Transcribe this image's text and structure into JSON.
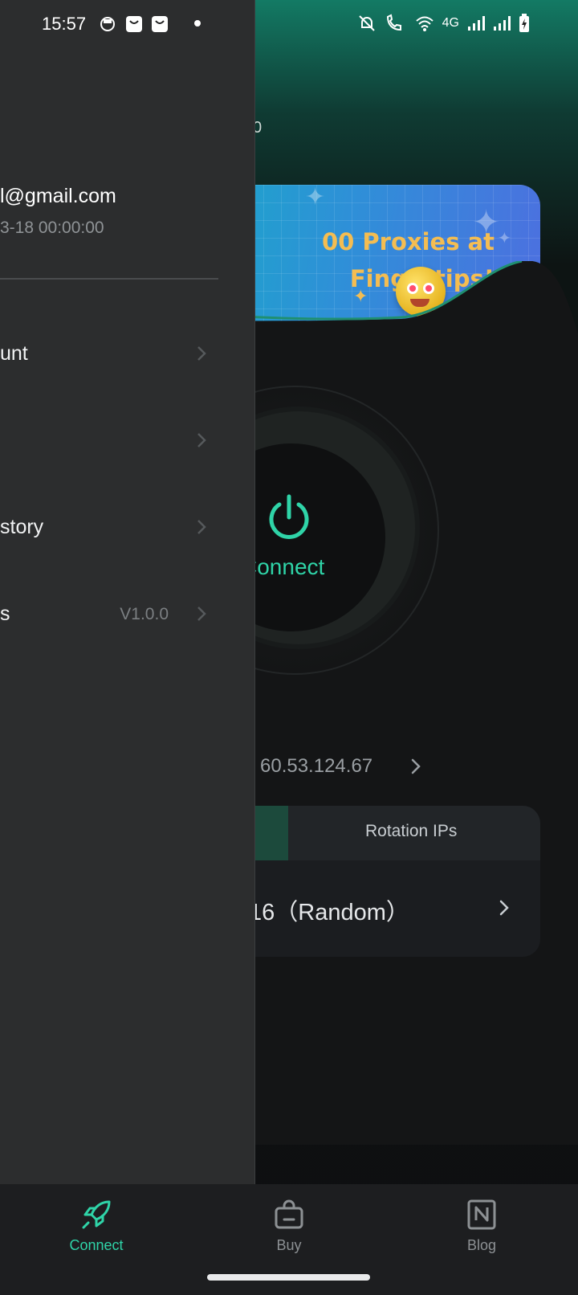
{
  "status_bar": {
    "time": "15:57",
    "network_label": "4G"
  },
  "main": {
    "header_fragment": "0",
    "banner": {
      "line1": "00 Proxies at",
      "line2": "Fingertips!"
    },
    "connect_label": "Connect",
    "ip_address": "60.53.124.67",
    "mode_tabs": {
      "rotation_label": "Rotation IPs"
    },
    "location_value": "16（Random）",
    "accent_color": "#2fd4a8"
  },
  "drawer": {
    "email": "l@gmail.com",
    "expiry": "3-18 00:00:00",
    "items": [
      {
        "label": "unt",
        "value": ""
      },
      {
        "label": "",
        "value": ""
      },
      {
        "label": "story",
        "value": ""
      },
      {
        "label": "s",
        "value": "V1.0.0"
      }
    ]
  },
  "bottom_nav": {
    "items": [
      {
        "label": "Connect",
        "icon": "rocket-icon",
        "active": true
      },
      {
        "label": "Buy",
        "icon": "shopping-bag-icon",
        "active": false
      },
      {
        "label": "Blog",
        "icon": "notion-icon",
        "active": false
      }
    ]
  }
}
